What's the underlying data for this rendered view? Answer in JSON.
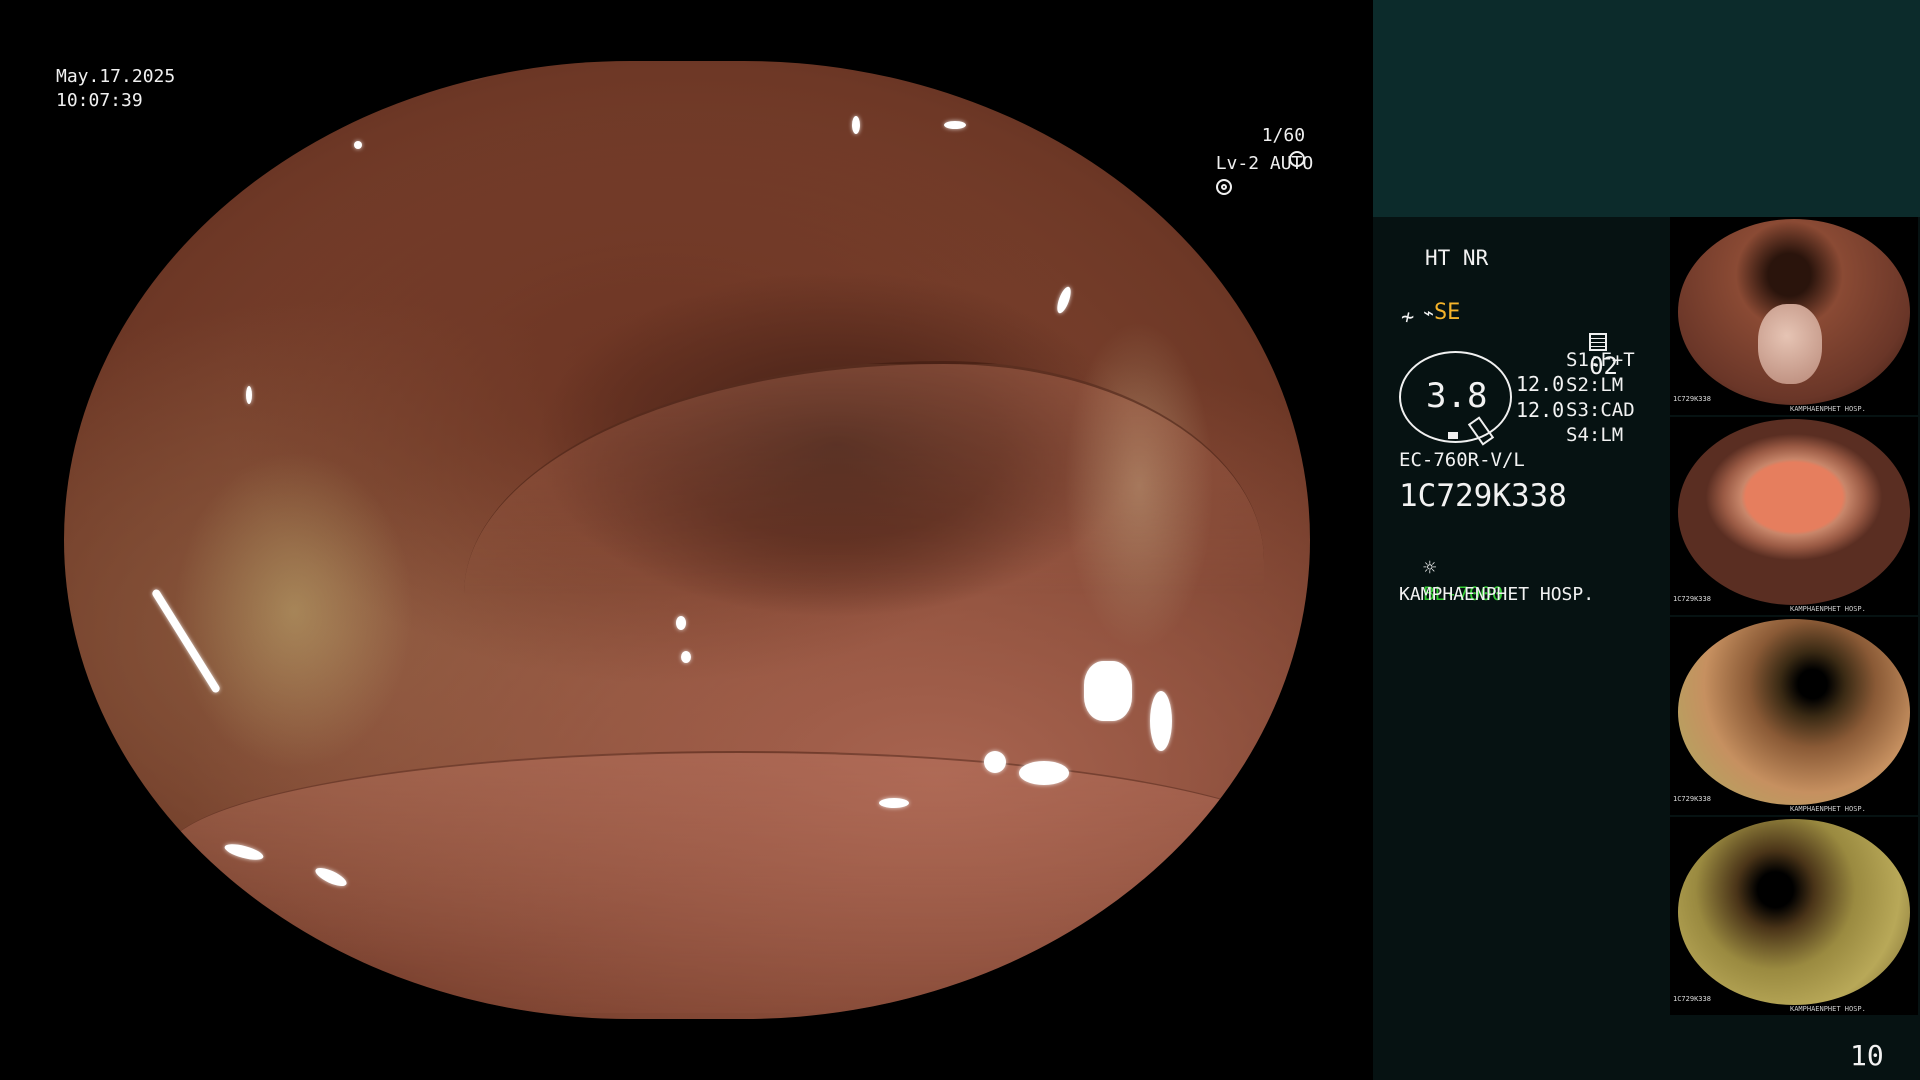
{
  "overlay": {
    "date": "May.17.2025",
    "time": "10:07:39",
    "shutter": "1/60",
    "shutter_icon": "aperture-icon",
    "iris": "Lv-2 AUTO",
    "iris_icon": "iris-icon"
  },
  "panel": {
    "ht_nr": "HT NR",
    "se_label": "SE",
    "se_color": "#f5b32a",
    "preset_icon": "preset-icon",
    "preset_number": "02",
    "ring_value": "3.8",
    "value_1": "12.0",
    "value_2": "12.0",
    "s1": "S1:F+T",
    "s2": "S2:LM",
    "s3": "S3:CAD",
    "s4": "S4:LM",
    "scope_model": "EC-760R-V/L",
    "serial": "1C729K338",
    "light_source": "BL-7000",
    "light_color": "#33cc33",
    "hospital": "KAMPHAENPHET HOSP."
  },
  "thumbnails": [
    {
      "id": "1C729K338",
      "caption": "KAMPHAENPHET HOSP."
    },
    {
      "id": "1C729K338",
      "caption": "KAMPHAENPHET HOSP."
    },
    {
      "id": "1C729K338",
      "caption": "KAMPHAENPHET HOSP."
    },
    {
      "id": "1C729K338",
      "caption": "KAMPHAENPHET HOSP."
    }
  ],
  "page_number": "10"
}
